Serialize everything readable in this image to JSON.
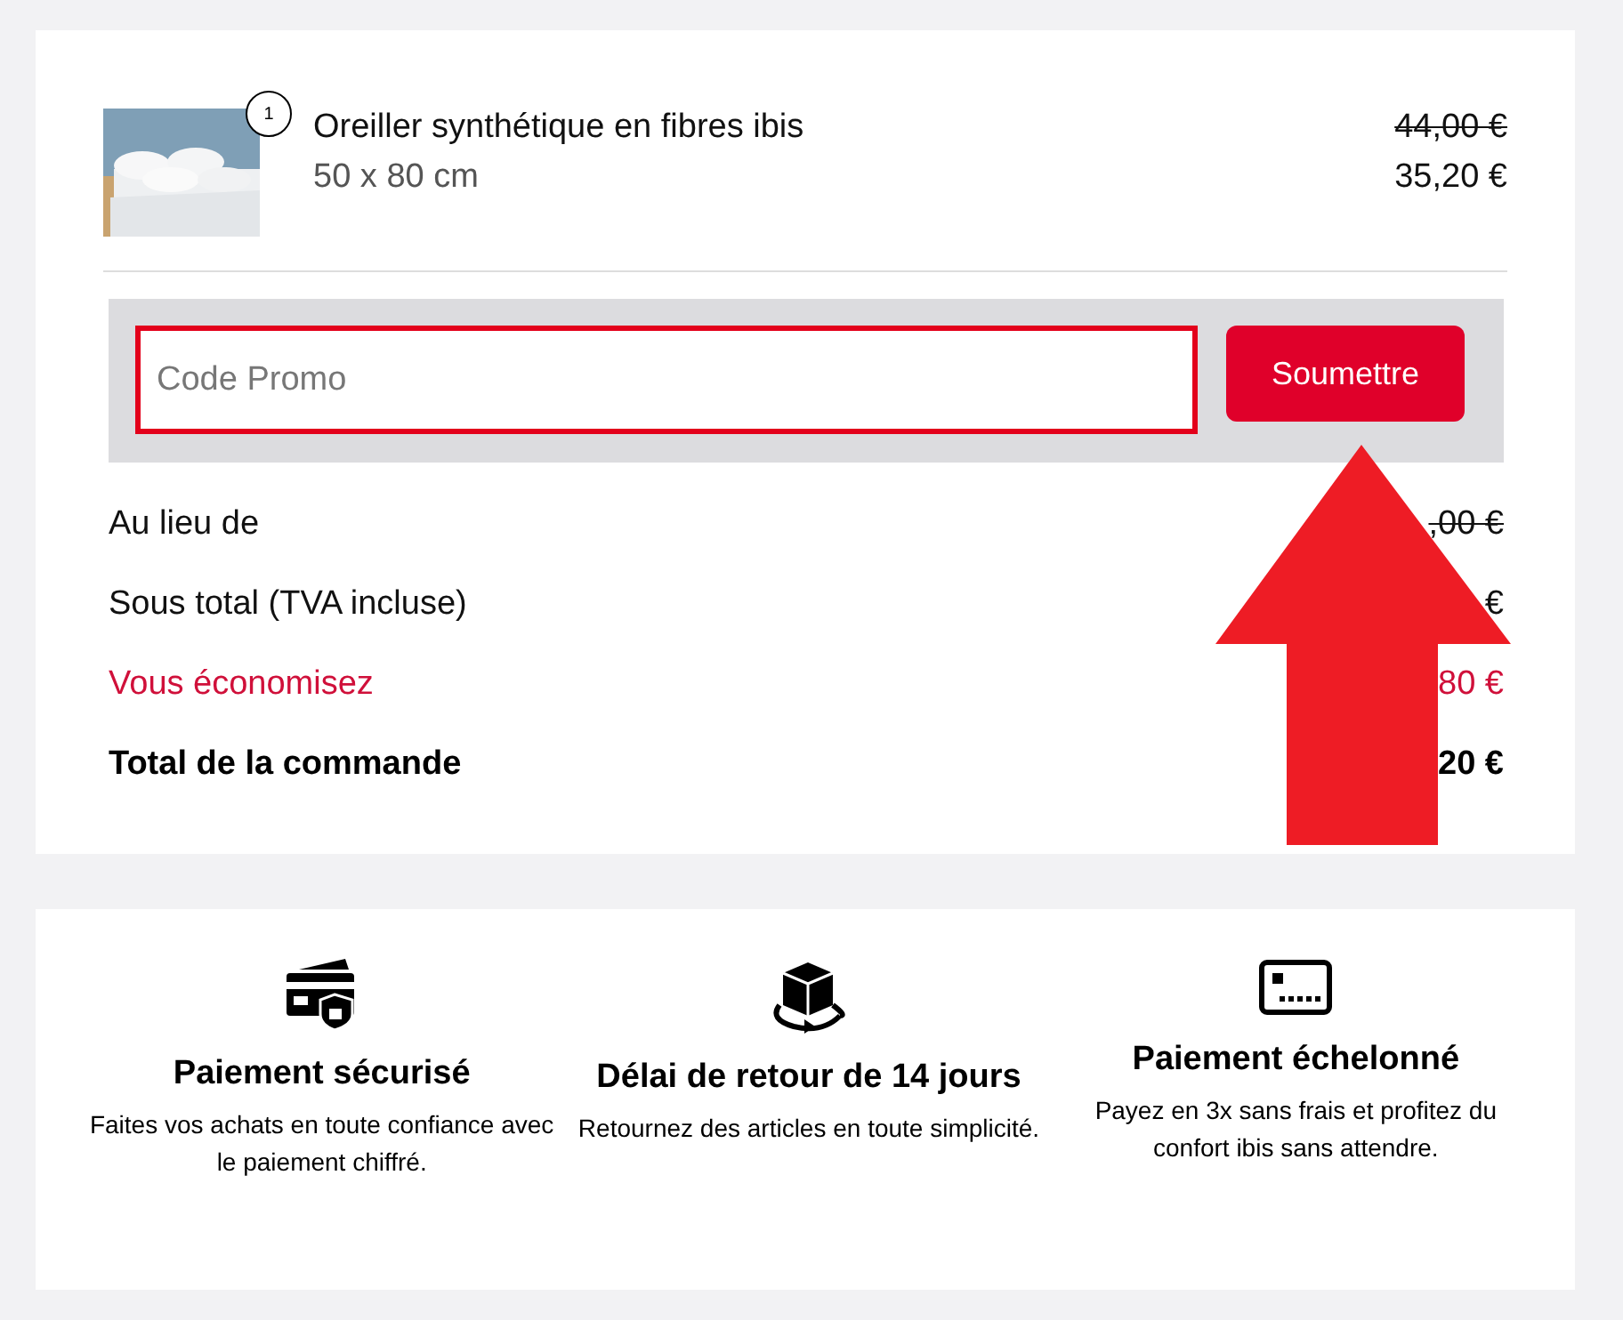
{
  "product": {
    "quantity": "1",
    "name": "Oreiller synthétique en fibres ibis",
    "size": "50 x 80 cm",
    "old_price": "44,00 €",
    "price": "35,20 €"
  },
  "promo": {
    "placeholder": "Code Promo",
    "button": "Soumettre"
  },
  "summary": [
    {
      "kind": "struck",
      "label": "Au lieu de",
      "value": ",00 €"
    },
    {
      "kind": "plain",
      "label": "Sous total (TVA incluse)",
      "value": "€"
    },
    {
      "kind": "saving",
      "label": "Vous économisez",
      "value": "80 €"
    },
    {
      "kind": "total",
      "label": "Total de la commande",
      "value": "20 €"
    }
  ],
  "features": [
    {
      "kind": "card",
      "title": "Paiement sécurisé",
      "text": "Faites vos achats en toute confiance avec le paiement chiffré."
    },
    {
      "kind": "box",
      "title": "Délai de retour de 14 jours",
      "text": "Retournez des articles en toute simplicité."
    },
    {
      "kind": "terminal",
      "title": "Paiement échelonné",
      "text": "Payez en 3x sans frais et profitez du confort ibis sans attendre."
    }
  ]
}
